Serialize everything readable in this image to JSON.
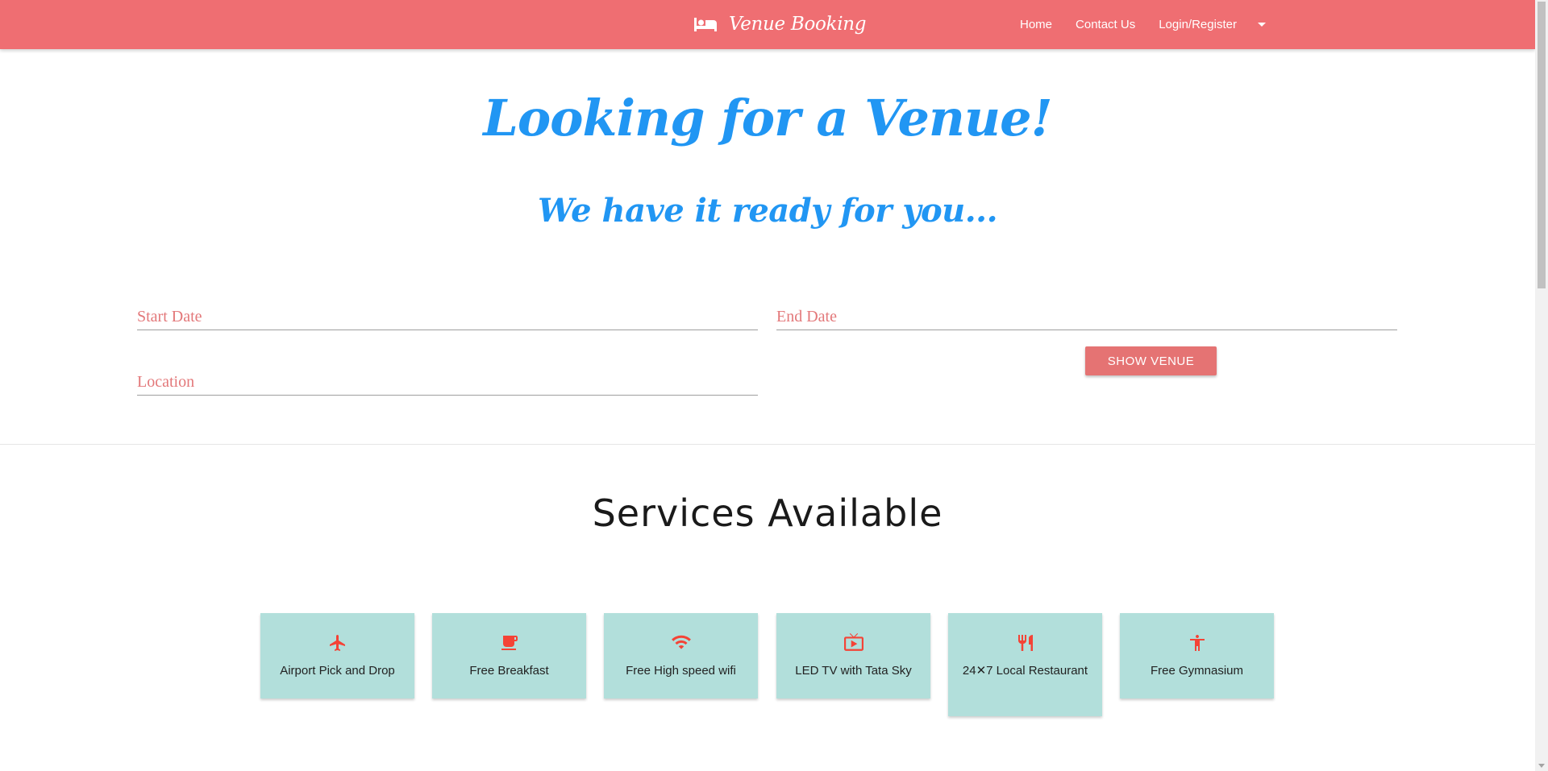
{
  "navbar": {
    "brand": "Venue Booking",
    "brand_icon": "hotel-bed-icon",
    "links": [
      "Home",
      "Contact Us",
      "Login/Register"
    ],
    "background_color": "#ef6e72"
  },
  "hero": {
    "title": "Looking for a Venue!",
    "subtitle": "We have it ready for you...",
    "color": "#2196f3"
  },
  "search_form": {
    "start_date_placeholder": "Start Date",
    "end_date_placeholder": "End Date",
    "location_placeholder": "Location",
    "submit_label": "SHOW  VENUE",
    "accent_color": "#e57373"
  },
  "services": {
    "title": "Services Available",
    "card_color": "#b2dfdb",
    "icon_color": "#f44336",
    "items": [
      {
        "label": "Airport Pick and Drop",
        "icon": "airplane-icon"
      },
      {
        "label": "Free Breakfast",
        "icon": "coffee-cup-icon"
      },
      {
        "label": "Free High speed wifi",
        "icon": "wifi-icon"
      },
      {
        "label": "LED TV with Tata Sky",
        "icon": "tv-icon"
      },
      {
        "label": "24✕7 Local Restaurant",
        "icon": "restaurant-icon"
      },
      {
        "label": "Free Gymnasium",
        "icon": "accessibility-person-icon"
      }
    ]
  }
}
